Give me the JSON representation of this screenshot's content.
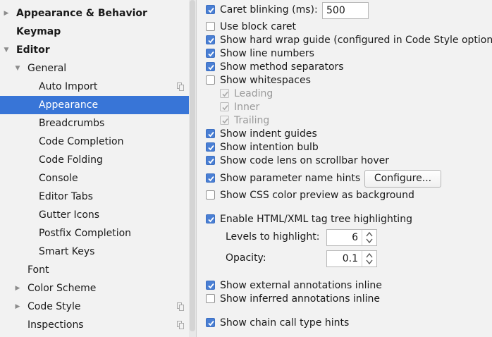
{
  "sidebar": {
    "items": [
      {
        "label": "Appearance & Behavior",
        "arrow": "right",
        "bold": true
      },
      {
        "label": "Keymap",
        "arrow": "",
        "bold": true
      },
      {
        "label": "Editor",
        "arrow": "down",
        "bold": true
      },
      {
        "label": "General",
        "arrow": "down",
        "bold": false
      },
      {
        "label": "Auto Import",
        "arrow": "",
        "bold": false,
        "copy_icon": true
      },
      {
        "label": "Appearance",
        "arrow": "",
        "bold": false,
        "selected": true
      },
      {
        "label": "Breadcrumbs",
        "arrow": "",
        "bold": false
      },
      {
        "label": "Code Completion",
        "arrow": "",
        "bold": false
      },
      {
        "label": "Code Folding",
        "arrow": "",
        "bold": false
      },
      {
        "label": "Console",
        "arrow": "",
        "bold": false
      },
      {
        "label": "Editor Tabs",
        "arrow": "",
        "bold": false
      },
      {
        "label": "Gutter Icons",
        "arrow": "",
        "bold": false
      },
      {
        "label": "Postfix Completion",
        "arrow": "",
        "bold": false
      },
      {
        "label": "Smart Keys",
        "arrow": "",
        "bold": false
      },
      {
        "label": "Font",
        "arrow": "",
        "bold": false
      },
      {
        "label": "Color Scheme",
        "arrow": "right",
        "bold": false
      },
      {
        "label": "Code Style",
        "arrow": "right",
        "bold": false,
        "copy_icon": true
      },
      {
        "label": "Inspections",
        "arrow": "",
        "bold": false,
        "copy_icon": true
      }
    ]
  },
  "options": {
    "caret_blinking": {
      "label": "Caret blinking (ms):",
      "checked": true,
      "value": "500"
    },
    "block_caret": {
      "label": "Use block caret",
      "checked": false
    },
    "hard_wrap": {
      "label": "Show hard wrap guide (configured in Code Style options)",
      "checked": true
    },
    "line_numbers": {
      "label": "Show line numbers",
      "checked": true
    },
    "method_separators": {
      "label": "Show method separators",
      "checked": true
    },
    "whitespaces": {
      "label": "Show whitespaces",
      "checked": false
    },
    "leading": {
      "label": "Leading",
      "checked": true,
      "disabled": true
    },
    "inner": {
      "label": "Inner",
      "checked": true,
      "disabled": true
    },
    "trailing": {
      "label": "Trailing",
      "checked": true,
      "disabled": true
    },
    "indent_guides": {
      "label": "Show indent guides",
      "checked": true
    },
    "intention_bulb": {
      "label": "Show intention bulb",
      "checked": true
    },
    "code_lens": {
      "label": "Show code lens on scrollbar hover",
      "checked": true
    },
    "param_hints": {
      "label": "Show parameter name hints",
      "checked": true,
      "button": "Configure..."
    },
    "css_color": {
      "label": "Show CSS color preview as background",
      "checked": false
    },
    "tag_tree": {
      "label": "Enable HTML/XML tag tree highlighting",
      "checked": true
    },
    "levels": {
      "label": "Levels to highlight:",
      "value": "6"
    },
    "opacity": {
      "label": "Opacity:",
      "value": "0.1"
    },
    "ext_annotations": {
      "label": "Show external annotations inline",
      "checked": true
    },
    "inferred_annotations": {
      "label": "Show inferred annotations inline",
      "checked": false
    },
    "chain_call": {
      "label": "Show chain call type hints",
      "checked": true
    }
  },
  "colors": {
    "selection": "#3875d7",
    "checkbox_on": "#4a7fd4",
    "background": "#f2f2f2"
  }
}
